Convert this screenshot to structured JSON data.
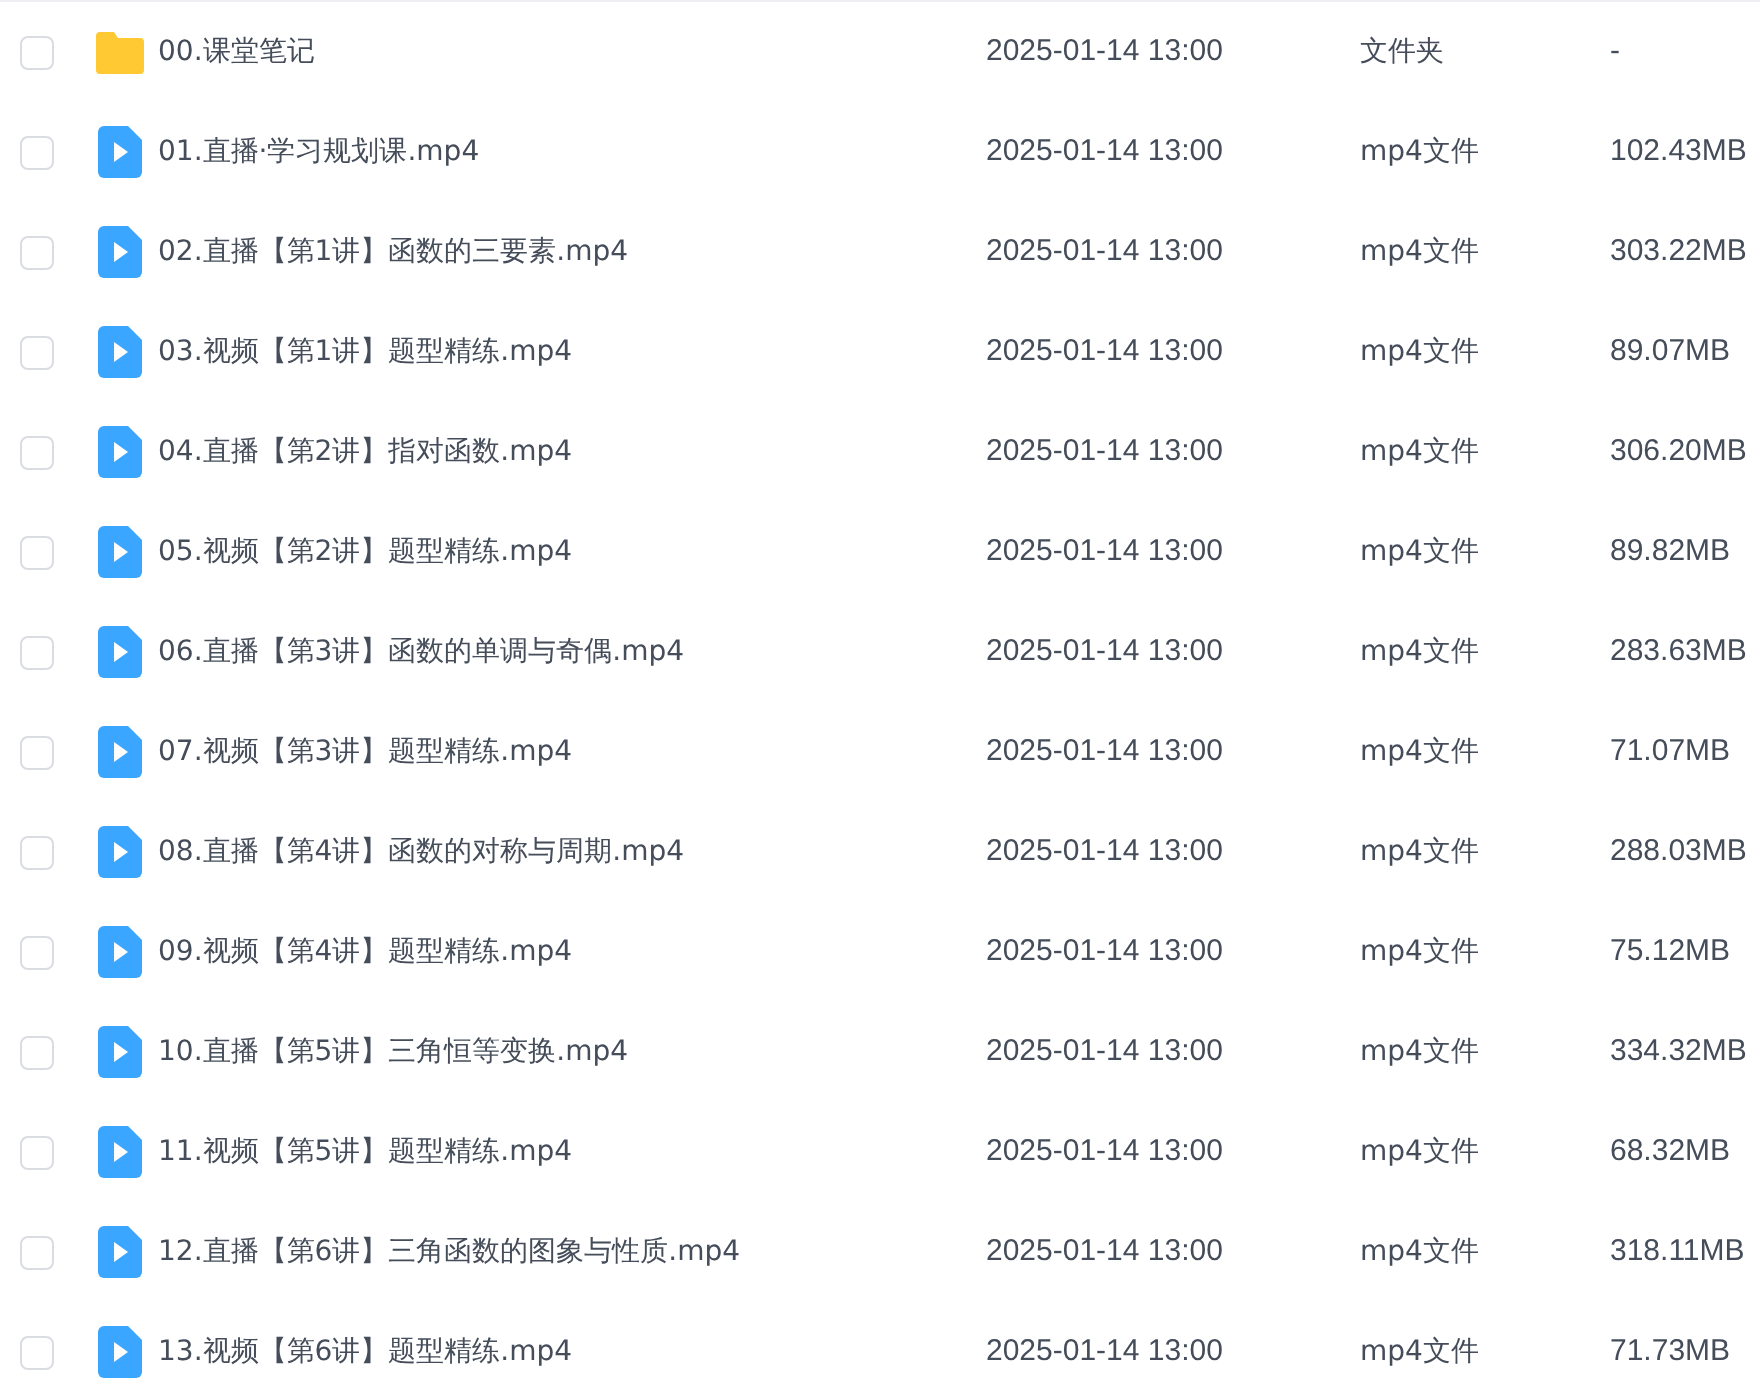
{
  "files": [
    {
      "kind": "folder",
      "checked": false,
      "name": "00.课堂笔记",
      "modified": "2025-01-14 13:00",
      "type": "文件夹",
      "size": "-"
    },
    {
      "kind": "video",
      "checked": false,
      "name": "01.直播·学习规划课.mp4",
      "modified": "2025-01-14 13:00",
      "type": "mp4文件",
      "size": "102.43MB"
    },
    {
      "kind": "video",
      "checked": false,
      "name": "02.直播【第1讲】函数的三要素.mp4",
      "modified": "2025-01-14 13:00",
      "type": "mp4文件",
      "size": "303.22MB"
    },
    {
      "kind": "video",
      "checked": false,
      "name": "03.视频【第1讲】题型精练.mp4",
      "modified": "2025-01-14 13:00",
      "type": "mp4文件",
      "size": "89.07MB"
    },
    {
      "kind": "video",
      "checked": false,
      "name": "04.直播【第2讲】指对函数.mp4",
      "modified": "2025-01-14 13:00",
      "type": "mp4文件",
      "size": "306.20MB"
    },
    {
      "kind": "video",
      "checked": false,
      "name": "05.视频【第2讲】题型精练.mp4",
      "modified": "2025-01-14 13:00",
      "type": "mp4文件",
      "size": "89.82MB"
    },
    {
      "kind": "video",
      "checked": false,
      "name": "06.直播【第3讲】函数的单调与奇偶.mp4",
      "modified": "2025-01-14 13:00",
      "type": "mp4文件",
      "size": "283.63MB"
    },
    {
      "kind": "video",
      "checked": false,
      "name": "07.视频【第3讲】题型精练.mp4",
      "modified": "2025-01-14 13:00",
      "type": "mp4文件",
      "size": "71.07MB"
    },
    {
      "kind": "video",
      "checked": false,
      "name": "08.直播【第4讲】函数的对称与周期.mp4",
      "modified": "2025-01-14 13:00",
      "type": "mp4文件",
      "size": "288.03MB"
    },
    {
      "kind": "video",
      "checked": false,
      "name": "09.视频【第4讲】题型精练.mp4",
      "modified": "2025-01-14 13:00",
      "type": "mp4文件",
      "size": "75.12MB"
    },
    {
      "kind": "video",
      "checked": false,
      "name": "10.直播【第5讲】三角恒等变换.mp4",
      "modified": "2025-01-14 13:00",
      "type": "mp4文件",
      "size": "334.32MB"
    },
    {
      "kind": "video",
      "checked": false,
      "name": "11.视频【第5讲】题型精练.mp4",
      "modified": "2025-01-14 13:00",
      "type": "mp4文件",
      "size": "68.32MB"
    },
    {
      "kind": "video",
      "checked": false,
      "name": "12.直播【第6讲】三角函数的图象与性质.mp4",
      "modified": "2025-01-14 13:00",
      "type": "mp4文件",
      "size": "318.11MB"
    },
    {
      "kind": "video",
      "checked": false,
      "name": "13.视频【第6讲】题型精练.mp4",
      "modified": "2025-01-14 13:00",
      "type": "mp4文件",
      "size": "71.73MB"
    }
  ]
}
